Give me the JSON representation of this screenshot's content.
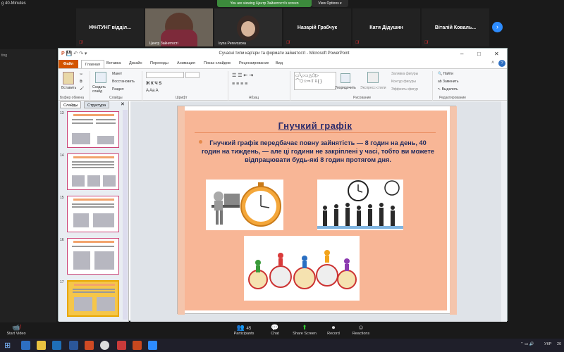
{
  "zoom": {
    "window_title": "g 40-Minutes",
    "banner": "You are viewing Центр Зайнятості's screen",
    "view_options": "View Options",
    "participants": [
      {
        "name": "ІФНТУНГ відділ..."
      },
      {
        "name": "Центр Зайнятості"
      },
      {
        "name": "Iryna Perevozova"
      },
      {
        "name": "Назарій Грабчук"
      },
      {
        "name": "Катя Дідушин"
      },
      {
        "name": "Віталій Коваль..."
      }
    ],
    "left_label": "ting",
    "bottom": {
      "start_video": "Start Video",
      "participants_label": "Participants",
      "participants_count": "45",
      "chat": "Chat",
      "share_screen": "Share Screen",
      "record": "Record",
      "reactions": "Reactions"
    },
    "taskbar_lang": "УКР",
    "taskbar_time": "20"
  },
  "ppt": {
    "title": "Сучасні типи кар'єри та формати зайнятості  -  Microsoft PowerPoint",
    "tabs": [
      "Файл",
      "Главная",
      "Вставка",
      "Дизайн",
      "Переходы",
      "Анимация",
      "Показ слайдов",
      "Рецензирование",
      "Вид"
    ],
    "ribbon": {
      "paste": "Вставить",
      "create_slide": "Создать слайд",
      "layout": "Макет",
      "reset": "Восстановить",
      "section": "Раздел",
      "clipboard": "Буфер обмена",
      "slides": "Слайды",
      "font": "Шрифт",
      "paragraph": "Абзац",
      "drawing": "Рисование",
      "arrange": "Упорядочить",
      "quick_styles": "Экспресс-стили",
      "shape_fill": "Заливка фигуры",
      "shape_outline": "Контур фигуры",
      "shape_effects": "Эффекты фигур",
      "find": "Найти",
      "replace": "Заменить",
      "select": "Выделить",
      "editing": "Редактирование"
    },
    "panel_tabs": [
      "Слайды",
      "Структура"
    ],
    "slide_numbers": [
      "13",
      "14",
      "15",
      "16",
      "17"
    ],
    "slide": {
      "title": "Гнучкий графік",
      "body": "Гнучкий графік передбачає повну зайнятість — 8 годин на день, 40 годин на тиждень, — але ці години не закріплені у часі, тобто ви можете відпрацювати будь-які 8 годин протягом дня."
    }
  }
}
